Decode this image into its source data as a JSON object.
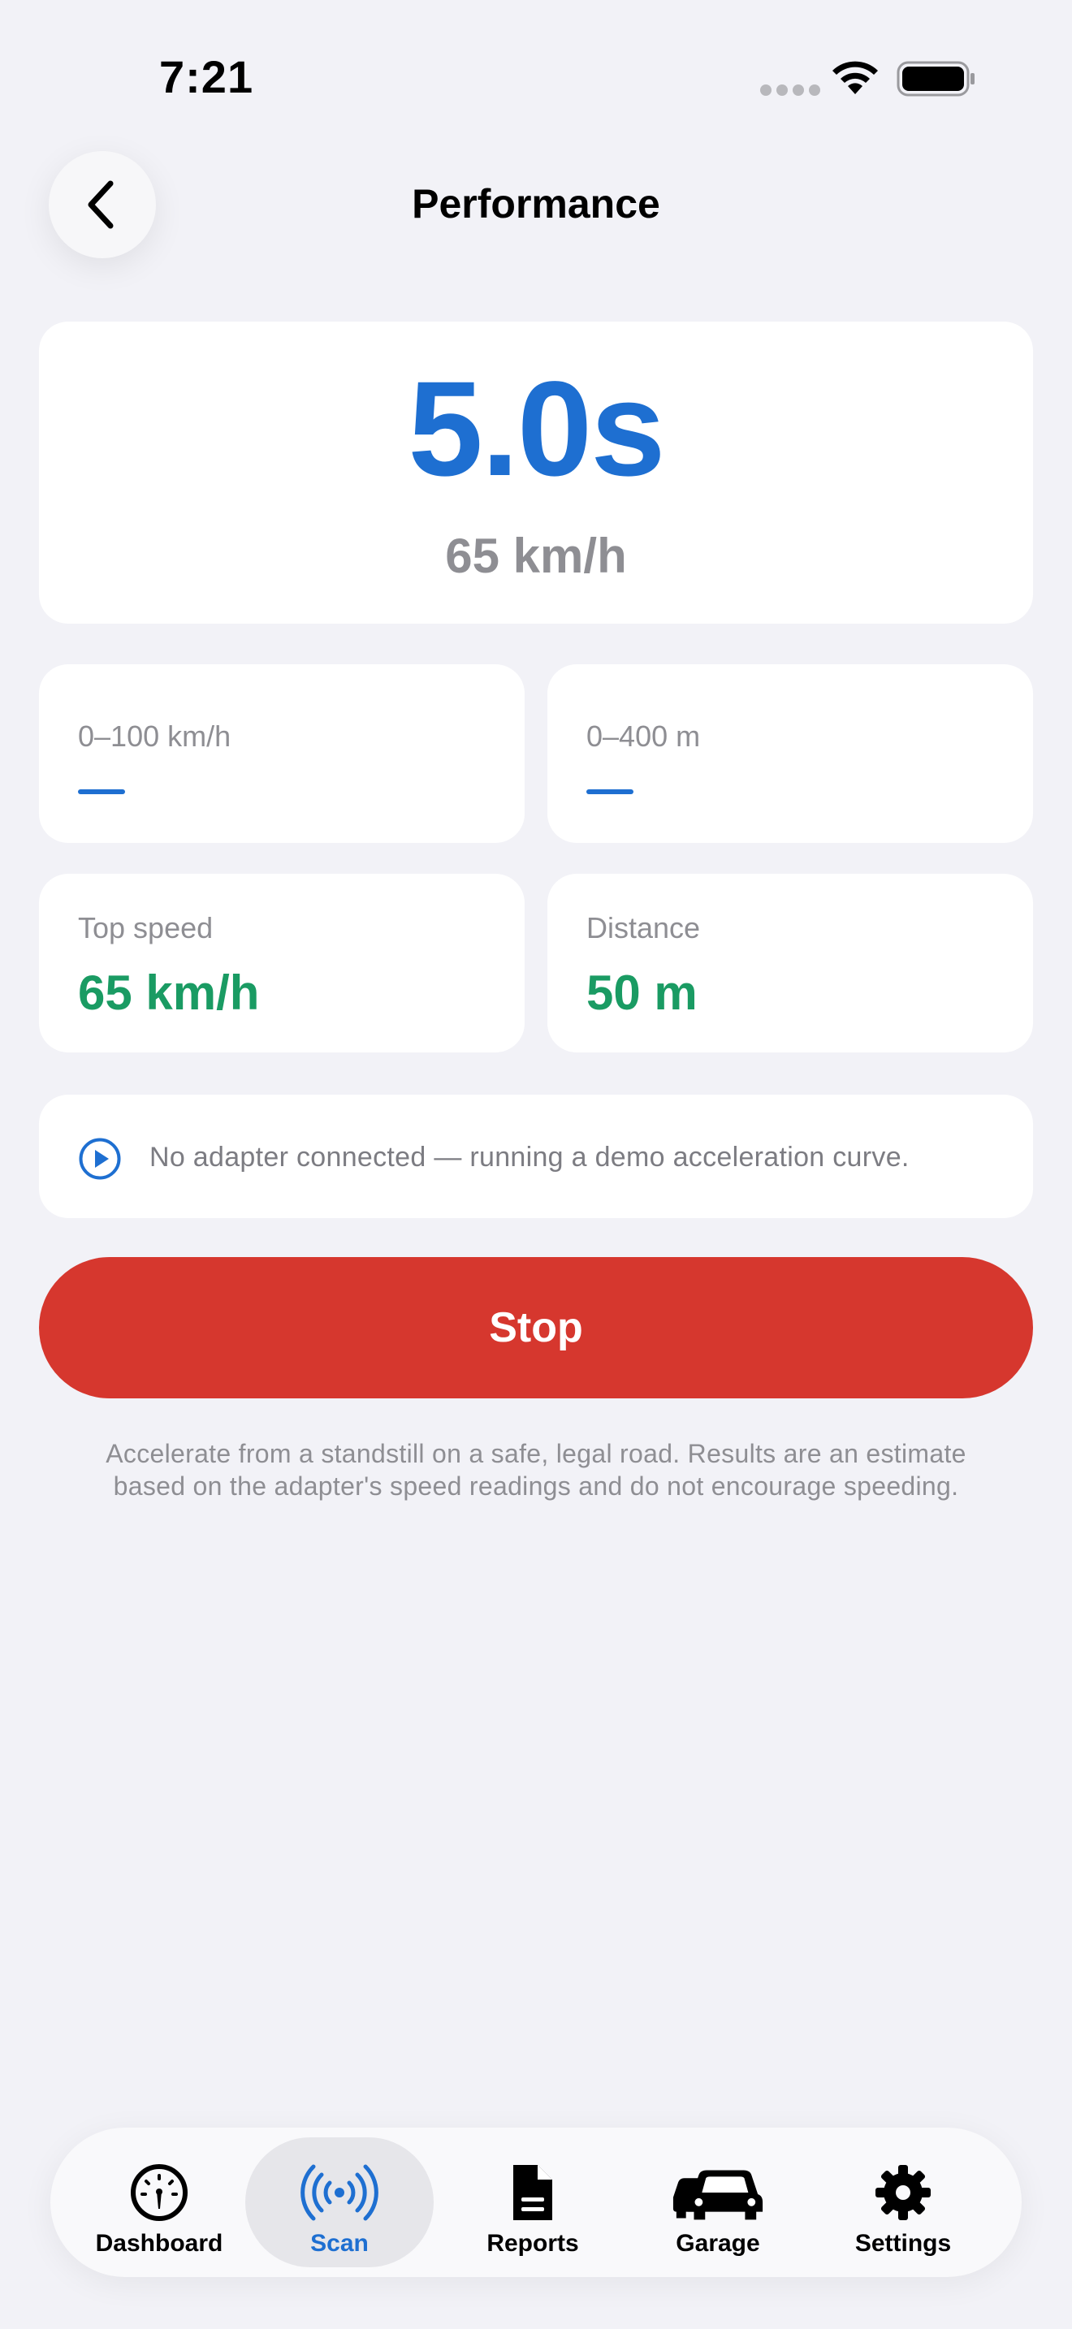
{
  "status_bar": {
    "time": "7:21"
  },
  "header": {
    "title": "Performance"
  },
  "hero": {
    "time": "5.0s",
    "speed": "65 km/h",
    "accent_color": "#1e6fd1"
  },
  "metrics": [
    {
      "label": "0–100 km/h",
      "value": "—"
    },
    {
      "label": "0–400 m",
      "value": "—"
    },
    {
      "label": "Top speed",
      "value": "65 km/h"
    },
    {
      "label": "Distance",
      "value": "50 m"
    }
  ],
  "info": {
    "icon": "play-circle-icon",
    "text": "No adapter connected — running a demo acceleration curve."
  },
  "stop_button": {
    "label": "Stop",
    "color": "#d6372e"
  },
  "disclaimer": {
    "line1": "Accelerate from a standstill on a safe, legal road. Results are an estimate",
    "line2": "based on the adapter's speed readings and do not encourage speeding."
  },
  "tab_bar": {
    "active": "Scan",
    "tabs": [
      {
        "label": "Dashboard",
        "icon": "gauge-icon"
      },
      {
        "label": "Scan",
        "icon": "broadcast-icon"
      },
      {
        "label": "Reports",
        "icon": "document-icon"
      },
      {
        "label": "Garage",
        "icon": "cars-icon"
      },
      {
        "label": "Settings",
        "icon": "gear-icon"
      }
    ]
  }
}
